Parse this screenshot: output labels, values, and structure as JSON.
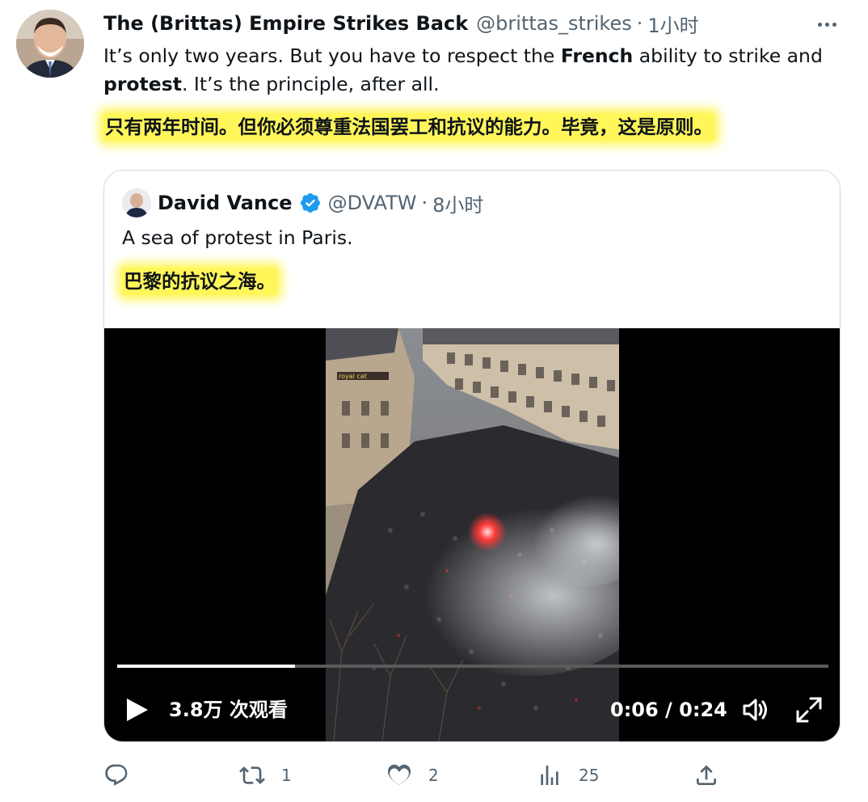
{
  "tweet": {
    "display_name": "The (Brittas) Empire Strikes Back",
    "handle": "@brittas_strikes",
    "separator": "·",
    "time": "1小时",
    "text_part1": "It’s only two years. But you have to respect the ",
    "text_bold1": "French",
    "text_part2": " ability to strike and ",
    "text_bold2": "protest",
    "text_part3": ". It’s the principle, after all.",
    "translation": "只有两年时间。但你必须尊重法国罢工和抗议的能力。毕竟，这是原则。"
  },
  "quoted": {
    "display_name": "David Vance",
    "handle": "@DVATW",
    "separator": "·",
    "time": "8小时",
    "text": "A sea of protest in Paris.",
    "translation": "巴黎的抗议之海。",
    "video": {
      "storefront_sign": "royal cat",
      "progress": 0.25,
      "views": "3.8万 次观看",
      "time_display": "0:06 / 0:24"
    }
  },
  "actions": {
    "reply": {
      "icon": "reply-icon",
      "count": ""
    },
    "retweet": {
      "icon": "retweet-icon",
      "count": "1"
    },
    "like": {
      "icon": "heart-icon",
      "count": "2"
    },
    "views": {
      "icon": "analytics-icon",
      "count": "25"
    },
    "share": {
      "icon": "share-icon",
      "count": ""
    }
  },
  "colors": {
    "text": "#0f1419",
    "secondary": "#536471",
    "highlight": "#fff65a",
    "verified": "#1d9bf0",
    "border": "#cfd9de"
  }
}
